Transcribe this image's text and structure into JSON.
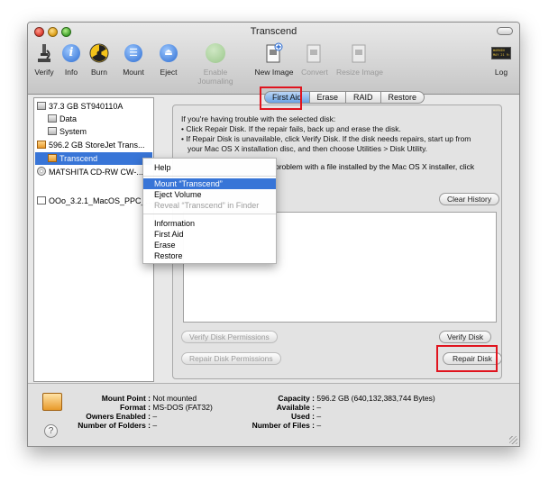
{
  "window": {
    "title": "Transcend"
  },
  "toolbar": {
    "items": [
      {
        "label": "Verify",
        "icon": "microscope-icon",
        "enabled": true
      },
      {
        "label": "Info",
        "icon": "info-icon",
        "enabled": true
      },
      {
        "label": "Burn",
        "icon": "burn-icon",
        "enabled": true
      },
      {
        "label": "Mount",
        "icon": "mount-icon",
        "enabled": true
      },
      {
        "label": "Eject",
        "icon": "eject-icon",
        "enabled": true
      },
      {
        "label": "Enable Journaling",
        "icon": "journal-icon",
        "enabled": false
      },
      {
        "label": "New Image",
        "icon": "new-image-icon",
        "enabled": true
      },
      {
        "label": "Convert",
        "icon": "convert-icon",
        "enabled": false
      },
      {
        "label": "Resize Image",
        "icon": "resize-image-icon",
        "enabled": false
      },
      {
        "label": "Log",
        "icon": "log-icon",
        "enabled": true
      }
    ],
    "log_icon_text": "WARNIN\nMAY 21 9:43"
  },
  "sidebar": {
    "items": [
      {
        "label": "37.3 GB ST940110A",
        "icon": "hard-disk-icon"
      },
      {
        "label": "Data",
        "icon": "volume-icon"
      },
      {
        "label": "System",
        "icon": "volume-icon"
      },
      {
        "label": "596.2 GB StoreJet Trans...",
        "icon": "external-disk-icon"
      },
      {
        "label": "Transcend",
        "icon": "external-volume-icon",
        "selected": true
      },
      {
        "label": "MATSHITA CD-RW CW-...",
        "icon": "optical-drive-icon"
      },
      {
        "label": "OOo_3.2.1_MacOS_PPC_...",
        "icon": "disk-image-icon"
      }
    ]
  },
  "tabs": [
    "First Aid",
    "Erase",
    "RAID",
    "Restore"
  ],
  "first_aid": {
    "intro": "If you're having trouble with the selected disk:",
    "bullet1": "• Click Repair Disk. If the repair fails, back up and erase the disk.",
    "bullet2": "• If Repair Disk is unavailable, click Verify Disk. If the disk needs repairs, start up from",
    "bullet2b": "your Mac OS X installation disc, and then choose Utilities > Disk Utility.",
    "perm_line": "problem with a file installed by the Mac OS X installer, click",
    "clear_history": "Clear History",
    "verify_permissions": "Verify Disk Permissions",
    "repair_permissions": "Repair Disk Permissions",
    "verify_disk": "Verify Disk",
    "repair_disk": "Repair Disk"
  },
  "context_menu": {
    "items": [
      {
        "label": "Help",
        "state": "normal"
      },
      {
        "label": "Mount “Transcend”",
        "state": "highlighted"
      },
      {
        "label": "Eject Volume",
        "state": "normal"
      },
      {
        "label": "Reveal “Transcend” in Finder",
        "state": "disabled"
      },
      {
        "label": "Information",
        "state": "normal"
      },
      {
        "label": "First Aid",
        "state": "normal"
      },
      {
        "label": "Erase",
        "state": "normal"
      },
      {
        "label": "Restore",
        "state": "normal"
      }
    ]
  },
  "details": {
    "mount_point_k": "Mount Point :",
    "mount_point_v": "Not mounted",
    "format_k": "Format :",
    "format_v": "MS-DOS (FAT32)",
    "owners_k": "Owners Enabled :",
    "owners_v": "–",
    "folders_k": "Number of Folders :",
    "folders_v": "–",
    "capacity_k": "Capacity :",
    "capacity_v": "596.2 GB (640,132,383,744 Bytes)",
    "available_k": "Available :",
    "available_v": "–",
    "used_k": "Used :",
    "used_v": "–",
    "files_k": "Number of Files :",
    "files_v": "–"
  },
  "colors": {
    "selection": "#3875d7",
    "highlight_box": "#e0141e"
  }
}
